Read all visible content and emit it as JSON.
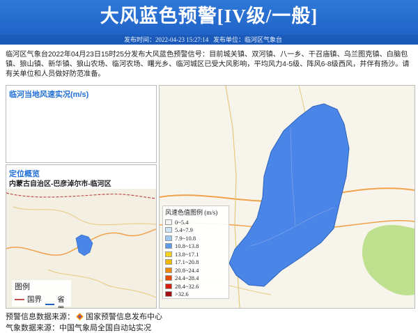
{
  "header": {
    "title": "大风蓝色预警[IV级/一般]",
    "publish_time": "发布时间：2022-04-23 15:27:14",
    "publisher": "发布单位：临河区气象台"
  },
  "description": "临河区气象台2022年04月23日15时25分发布大风蓝色预警信号：目前城关镇、双河镇、八一乡、干召庙镇、乌兰图克镇、白脑包镇、狼山镇、新华镇、狼山农场、临河农场、曙光乡、临河城区已受大风影响，平均风力4-5级、阵风6-8级西风，并伴有扬沙。请有关单位和人员做好防范准备。",
  "wind_panel": {
    "title": "临河当地风速实况(m/s)"
  },
  "location_panel": {
    "title": "定位概览",
    "region": "内蒙古自治区-巴彦淖尔市-临河区",
    "legend_title": "图例",
    "legend_items": [
      {
        "label": "国界",
        "color": "#c0504d"
      },
      {
        "label": "省界",
        "color": "#1f5fbf"
      }
    ]
  },
  "speed_legend": {
    "title": "风速色值图例 (m/s)",
    "items": [
      {
        "label": "0~5.4",
        "color": "#f4f4f4"
      },
      {
        "label": "5.4~7.9",
        "color": "#cfe3f7"
      },
      {
        "label": "7.9~10.8",
        "color": "#9cc8f0"
      },
      {
        "label": "10.8~13.8",
        "color": "#5b9be6"
      },
      {
        "label": "13.8~17.1",
        "color": "#f7d21a"
      },
      {
        "label": "17.1~20.8",
        "color": "#f5b800"
      },
      {
        "label": "20.8~24.4",
        "color": "#f08a00"
      },
      {
        "label": "24.4~28.4",
        "color": "#e84d00"
      },
      {
        "label": "28.4~32.6",
        "color": "#d41d0e"
      },
      {
        "label": ">32.6",
        "color": "#a50f0f"
      }
    ]
  },
  "footer": {
    "source_label": "预警信息数据来源：",
    "source_name": "国家预警信息发布中心",
    "weather_source": "气象数据来源：中国气象局全国自动站实况"
  },
  "colors": {
    "header": "#2368cc",
    "warning_area": "#4a86e8"
  }
}
